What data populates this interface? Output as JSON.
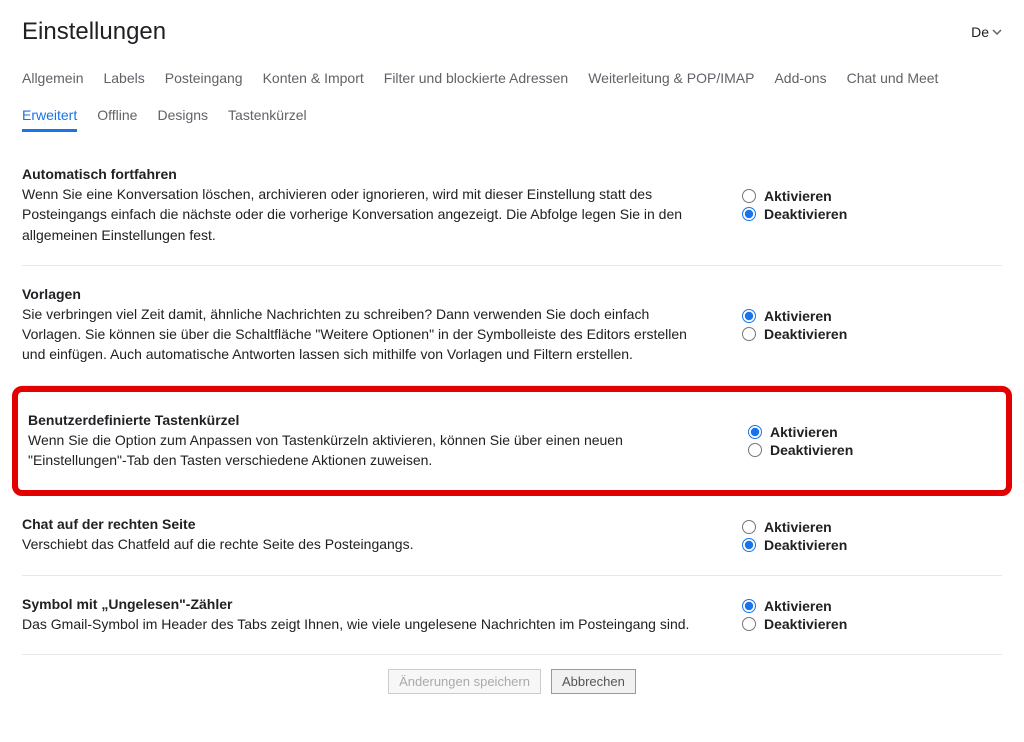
{
  "header": {
    "title": "Einstellungen",
    "language": "De"
  },
  "tabs_row1": [
    "Allgemein",
    "Labels",
    "Posteingang",
    "Konten & Import",
    "Filter und blockierte Adressen",
    "Weiterleitung & POP/IMAP",
    "Add-ons",
    "Chat und Meet"
  ],
  "tabs_row2": [
    "Erweitert",
    "Offline",
    "Designs",
    "Tastenkürzel"
  ],
  "active_tab": "Erweitert",
  "radio_labels": {
    "activate": "Aktivieren",
    "deactivate": "Deaktivieren"
  },
  "sections": {
    "auto_advance": {
      "title": "Automatisch fortfahren",
      "desc": "Wenn Sie eine Konversation löschen, archivieren oder ignorieren, wird mit dieser Einstellung statt des Posteingangs einfach die nächste oder die vorherige Konversation angezeigt. Die Abfolge legen Sie in den allgemeinen Einstellungen fest.",
      "selected": "deactivate"
    },
    "templates": {
      "title": "Vorlagen",
      "desc": "Sie verbringen viel Zeit damit, ähnliche Nachrichten zu schreiben? Dann verwenden Sie doch einfach Vorlagen. Sie können sie über die Schaltfläche \"Weitere Optionen\" in der Symbolleiste des Editors erstellen und einfügen. Auch automatische Antworten lassen sich mithilfe von Vorlagen und Filtern erstellen.",
      "selected": "activate"
    },
    "custom_shortcuts": {
      "title": "Benutzerdefinierte Tastenkürzel",
      "desc": "Wenn Sie die Option zum Anpassen von Tastenkürzeln aktivieren, können Sie über einen neuen \"Einstellungen\"-Tab den Tasten verschiedene Aktionen zuweisen.",
      "selected": "activate"
    },
    "chat_right": {
      "title": "Chat auf der rechten Seite",
      "desc": "Verschiebt das Chatfeld auf die rechte Seite des Posteingangs.",
      "selected": "deactivate"
    },
    "unread_icon": {
      "title": "Symbol mit „Ungelesen\"-Zähler",
      "desc": "Das Gmail-Symbol im Header des Tabs zeigt Ihnen, wie viele ungelesene Nachrichten im Posteingang sind.",
      "selected": "activate"
    }
  },
  "footer": {
    "save": "Änderungen speichern",
    "cancel": "Abbrechen"
  }
}
